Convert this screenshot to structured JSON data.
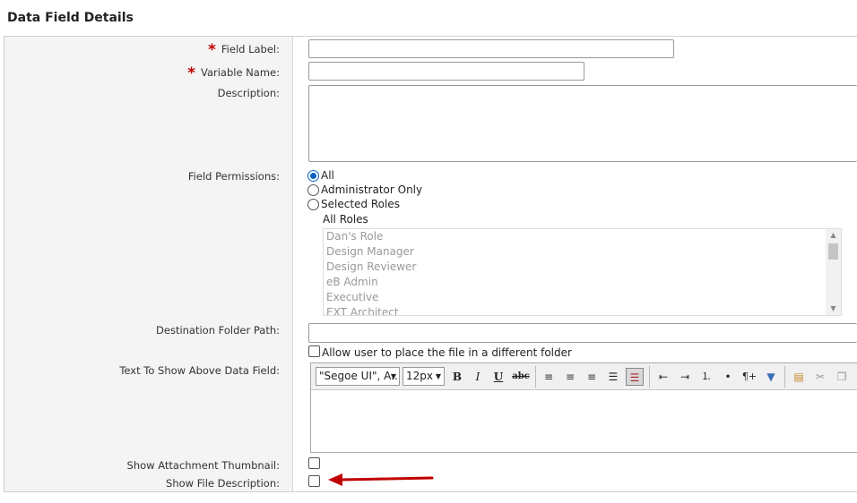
{
  "section_title": "Data Field Details",
  "labels": {
    "field_label": "Field Label:",
    "variable_name": "Variable Name:",
    "description": "Description:",
    "field_permissions": "Field Permissions:",
    "destination_folder_path": "Destination Folder Path:",
    "text_above": "Text To Show Above Data Field:",
    "show_thumbnail": "Show Attachment Thumbnail:",
    "show_file_description": "Show File Description:"
  },
  "required_mark": "*",
  "permissions": {
    "options": [
      "All",
      "Administrator Only",
      "Selected Roles"
    ],
    "selected": "All",
    "roles_title": "All Roles",
    "roles": [
      "Dan's Role",
      "Design Manager",
      "Design Reviewer",
      "eB Admin",
      "Executive",
      "EXT Architect"
    ]
  },
  "allow_different_folder": "Allow user to place the file in a different folder",
  "editor": {
    "font_family": "\"Segoe UI\", A...",
    "font_size": "12px",
    "bold": "B",
    "italic": "I",
    "underline": "U",
    "strike": "abc",
    "paragraph": "¶+"
  },
  "colors": {
    "required": "#c00000",
    "radio_selected": "#0a64c8",
    "arrow": "#c00000"
  }
}
